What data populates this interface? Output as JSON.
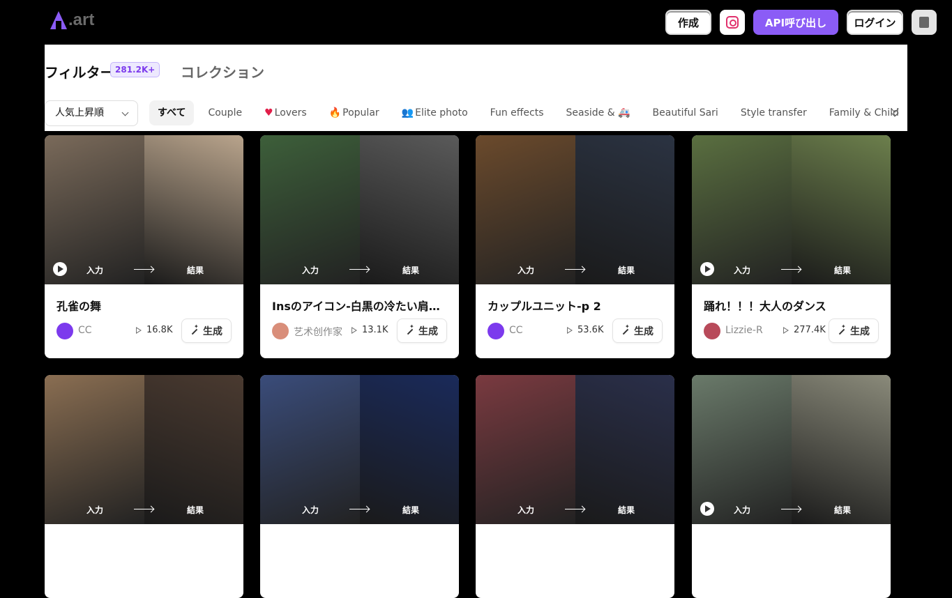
{
  "header": {
    "logo_text": ".art",
    "create_label": "作成",
    "api_label": "API呼び出し",
    "login_label": "ログイン"
  },
  "filters": {
    "tab_filter": "フィルター",
    "count": "281.2K+",
    "tab_collection": "コレクション",
    "sort_label": "人気上昇順",
    "categories": [
      {
        "icon": "",
        "label": "すべて"
      },
      {
        "icon": "",
        "label": "Couple"
      },
      {
        "icon": "heart",
        "label": "Lovers"
      },
      {
        "icon": "fire",
        "label": "Popular"
      },
      {
        "icon": "people",
        "label": "Elite photo"
      },
      {
        "icon": "",
        "label": "Fun effects"
      },
      {
        "icon": "",
        "label": "Seaside & 🚑"
      },
      {
        "icon": "",
        "label": "Beautiful Sari"
      },
      {
        "icon": "",
        "label": "Style transfer"
      },
      {
        "icon": "",
        "label": "Family & Child"
      }
    ]
  },
  "thumb_labels": {
    "input": "入力",
    "output": "結果"
  },
  "cards": [
    {
      "title": "孔雀の舞",
      "author": "CC",
      "views": "16.8K",
      "button": "生成",
      "colors": [
        "#7a6a5a",
        "#b9a48c"
      ],
      "avatar": "#7c3aed",
      "play": true
    },
    {
      "title": "Insのアイコン-白黒の冷たい肩で…",
      "author": "艺术创作家",
      "views": "13.1K",
      "button": "生成",
      "colors": [
        "#3d5f3a",
        "#5a5a5a"
      ],
      "avatar": "#d98e7a",
      "play": false
    },
    {
      "title": "カップルユニット-p 2",
      "author": "CC",
      "views": "53.6K",
      "button": "生成",
      "colors": [
        "#6b4a2c",
        "#2b3342"
      ],
      "avatar": "#7c3aed",
      "play": false
    },
    {
      "title": "踊れ！！！大人のダンス",
      "author": "Lizzie-R",
      "views": "277.4K",
      "button": "生成",
      "colors": [
        "#5a6f40",
        "#6c7f4c"
      ],
      "avatar": "#b84a5a",
      "play": true
    },
    {
      "title": "",
      "author": "",
      "views": "",
      "button": "",
      "colors": [
        "#8a6e52",
        "#4a3a30"
      ],
      "avatar": "#777",
      "play": false
    },
    {
      "title": "",
      "author": "",
      "views": "",
      "button": "",
      "colors": [
        "#3a4c7a",
        "#1a2a5a"
      ],
      "avatar": "#777",
      "play": false
    },
    {
      "title": "",
      "author": "",
      "views": "",
      "button": "",
      "colors": [
        "#7a3a40",
        "#2a2f4a"
      ],
      "avatar": "#777",
      "play": false
    },
    {
      "title": "",
      "author": "",
      "views": "",
      "button": "",
      "colors": [
        "#6a7a6a",
        "#8a8a7a"
      ],
      "avatar": "#777",
      "play": true
    }
  ]
}
